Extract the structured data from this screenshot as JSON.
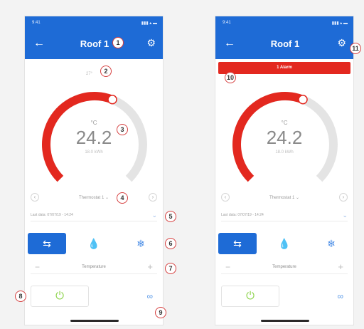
{
  "left_screen": {
    "status": {
      "time": "9:41",
      "icons": "▮▮▮ ▴ ▬"
    },
    "title": "Roof 1",
    "setpoint": "27°",
    "temp_unit": "°C",
    "temp_value": "24.2",
    "temp_sub": "18.0 kWh",
    "thermostat": "Thermostat 1 ⌄",
    "last_update": "Last data: 07/07/19 - 14:24",
    "mode_temperature_label": "Temperature",
    "gauge_fraction": 0.58
  },
  "right_screen": {
    "status": {
      "time": "9:41",
      "icons": "▮▮▮ ▴ ▬"
    },
    "title": "Roof 1",
    "alert": "1 Alarm",
    "temp_unit": "°C",
    "temp_value": "24.2",
    "temp_sub": "18.0 kWh",
    "thermostat": "Thermostat 1 ⌄",
    "last_update": "Last data: 07/07/19 - 14:24",
    "mode_temperature_label": "Temperature",
    "gauge_fraction": 0.58
  },
  "callouts": [
    "1",
    "2",
    "3",
    "4",
    "5",
    "6",
    "7",
    "8",
    "9",
    "10",
    "11"
  ],
  "colors": {
    "header": "#1e6bd6",
    "arc_active": "#e3281f",
    "arc_track": "#e4e4e4",
    "alert": "#e3281f",
    "power": "#8cd34a"
  },
  "icons": [
    "back-arrow-icon",
    "gear-icon",
    "swap-mode-icon",
    "flame-icon",
    "snowflake-icon",
    "minus-icon",
    "plus-icon",
    "power-icon",
    "link-icon",
    "chevron-down-icon"
  ]
}
